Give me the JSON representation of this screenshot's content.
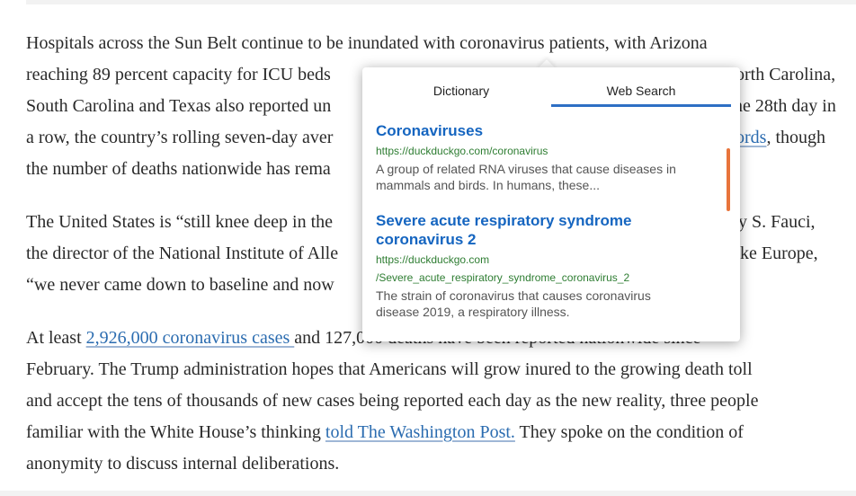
{
  "article": {
    "p1": {
      "l1": "Hospitals across the Sun Belt continue to be inundated with coronavirus patients, with Arizona",
      "l2a": "reaching 89 percent capacity for ICU beds",
      "l2b": "orth Carolina,",
      "l3a": "South Carolina and Texas also reported un",
      "l3b": "ne 28th day in",
      "l4a": "a row, the country’s rolling seven-day aver",
      "l4link": "ords",
      "l4b": ", though",
      "l5": "the number of deaths nationwide has rema"
    },
    "p2": {
      "l1a": "The United States is “still knee deep in the",
      "l1b": "y S. Fauci,",
      "l2a": "the director of the National Institute of Alle",
      "l2b": "ke Europe,",
      "l3": "“we never came down to baseline and now"
    },
    "p3": {
      "l1a": "At least ",
      "l1link": "2,926,000 coronavirus cases ",
      "l1b": "and 127,000 deaths have been reported nationwide since",
      "l2": "February. The Trump administration hopes that Americans will grow inured to the growing death toll",
      "l3": "and accept the tens of thousands of new cases being reported each day as the new reality, three people",
      "l4a": "familiar with the White House’s thinking ",
      "l4link": "told The Washington Post.",
      "l4b": " They spoke on the condition of",
      "l5": "anonymity to discuss internal deliberations."
    }
  },
  "popup": {
    "tabs": {
      "dictionary": "Dictionary",
      "web_search": "Web Search"
    },
    "active_tab": "web_search",
    "accent_color": "#2e6fc4",
    "results": [
      {
        "title": "Coronaviruses",
        "url": "https://duckduckgo.com/coronavirus",
        "snippet_l1": "A group of related RNA viruses that cause diseases in",
        "snippet_l2": "mammals and birds. In humans, these..."
      },
      {
        "title_l1": "Severe acute respiratory syndrome",
        "title_l2": "coronavirus 2",
        "url_l1": "https://duckduckgo.com",
        "url_l2": "/Severe_acute_respiratory_syndrome_coronavirus_2",
        "snippet_l1": "The strain of coronavirus that causes coronavirus",
        "snippet_l2": "disease 2019, a respiratory illness."
      }
    ]
  }
}
